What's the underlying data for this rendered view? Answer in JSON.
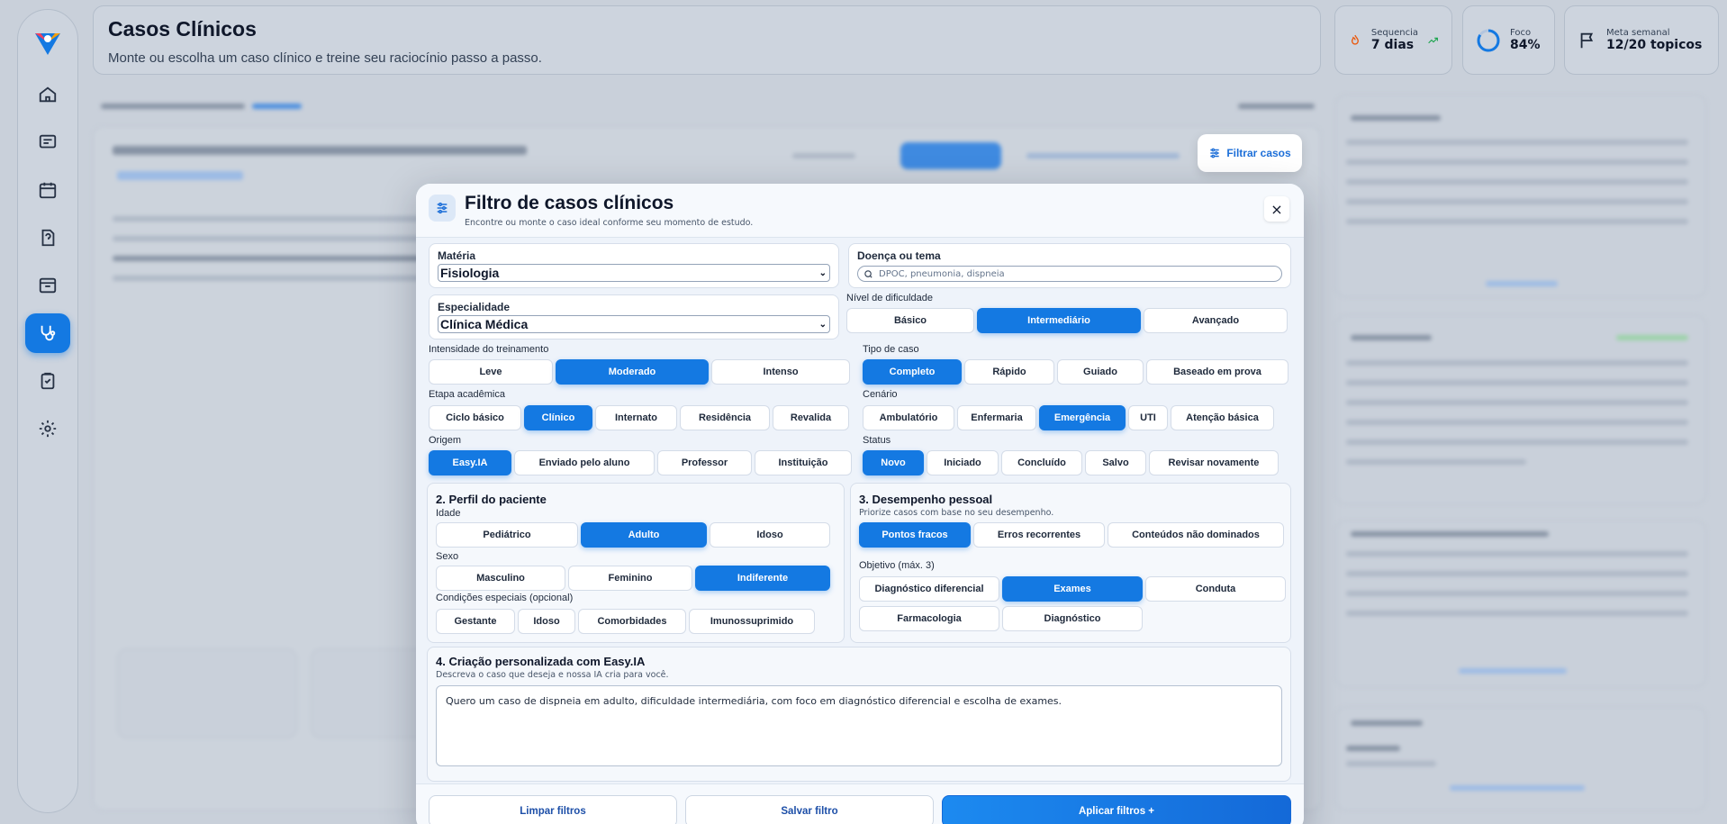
{
  "header": {
    "title": "Casos Clínicos",
    "subtitle": "Monte ou escolha um caso clínico e treine seu raciocínio passo a passo."
  },
  "stats": [
    {
      "label": "Sequencia",
      "value": "7 dias",
      "icon": "flame-icon"
    },
    {
      "label": "Foco",
      "value": "84%",
      "progress": 0.84,
      "icon": "focus-ring-icon"
    },
    {
      "label": "Meta semanal",
      "value": "12/20 topicos",
      "icon": "flag-icon"
    }
  ],
  "sidebar": {
    "items": [
      "home",
      "chat",
      "calendar",
      "quiz",
      "inbox",
      "stethoscope",
      "clipboard",
      "settings"
    ],
    "active": "stethoscope"
  },
  "filter_button": {
    "label": "Filtrar casos"
  },
  "modal": {
    "title": "Filtro de casos clínicos",
    "subtitle": "Encontre ou monte o caso ideal conforme seu momento de estudo.",
    "close": "×",
    "materia": {
      "label": "Matéria",
      "value": "Fisiologia"
    },
    "doenca": {
      "label": "Doença ou tema",
      "placeholder": "DPOC, pneumonia, dispneia"
    },
    "especialidade": {
      "label": "Especialidade",
      "value": "Clínica Médica"
    },
    "dificuldade": {
      "label": "Nível de dificuldade",
      "options": [
        "Básico",
        "Intermediário",
        "Avançado"
      ],
      "selected": "Intermediário"
    },
    "intensidade": {
      "label": "Intensidade do treinamento",
      "options": [
        "Leve",
        "Moderado",
        "Intenso"
      ],
      "selected": "Moderado"
    },
    "tipo": {
      "label": "Tipo de caso",
      "options": [
        "Completo",
        "Rápido",
        "Guiado",
        "Baseado em prova"
      ],
      "selected": "Completo"
    },
    "etapa": {
      "label": "Etapa acadêmica",
      "options": [
        "Ciclo básico",
        "Clínico",
        "Internato",
        "Residência",
        "Revalida"
      ],
      "selected": "Clínico"
    },
    "cenario": {
      "label": "Cenário",
      "options": [
        "Ambulatório",
        "Enfermaria",
        "Emergência",
        "UTI",
        "Atenção básica"
      ],
      "selected": "Emergência"
    },
    "origem": {
      "label": "Origem",
      "options": [
        "Easy.IA",
        "Enviado pelo aluno",
        "Professor",
        "Instituição"
      ],
      "selected": "Easy.IA"
    },
    "status": {
      "label": "Status",
      "options": [
        "Novo",
        "Iniciado",
        "Concluído",
        "Salvo",
        "Revisar novamente"
      ],
      "selected": "Novo"
    },
    "perfil": {
      "title": "2. Perfil do paciente",
      "idade": {
        "label": "Idade",
        "options": [
          "Pediátrico",
          "Adulto",
          "Idoso"
        ],
        "selected": "Adulto"
      },
      "sexo": {
        "label": "Sexo",
        "options": [
          "Masculino",
          "Feminino",
          "Indiferente"
        ],
        "selected": "Indiferente"
      },
      "condicoes": {
        "label": "Condições especiais (opcional)",
        "options": [
          "Gestante",
          "Idoso",
          "Comorbidades",
          "Imunossuprimido"
        ]
      }
    },
    "desempenho": {
      "title": "3. Desempenho pessoal",
      "subtitle": "Priorize casos com base no seu desempenho.",
      "options": [
        "Pontos fracos",
        "Erros recorrentes",
        "Conteúdos não dominados"
      ],
      "selected": "Pontos fracos",
      "objetivo": {
        "label": "Objetivo (máx. 3)",
        "options": [
          "Diagnóstico diferencial",
          "Exames",
          "Conduta",
          "Farmacologia",
          "Diagnóstico"
        ],
        "selected": "Exames"
      }
    },
    "criacao": {
      "title": "4. Criação personalizada com Easy.IA",
      "subtitle": "Descreva o caso que deseja e nossa IA cria para você.",
      "text": "Quero um caso de dispneia em adulto, dificuldade intermediária, com foco em diagnóstico diferencial e escolha de exames."
    },
    "footer": {
      "clear": "Limpar filtros",
      "save": "Salvar filtro",
      "apply": "Aplicar filtros +"
    }
  }
}
